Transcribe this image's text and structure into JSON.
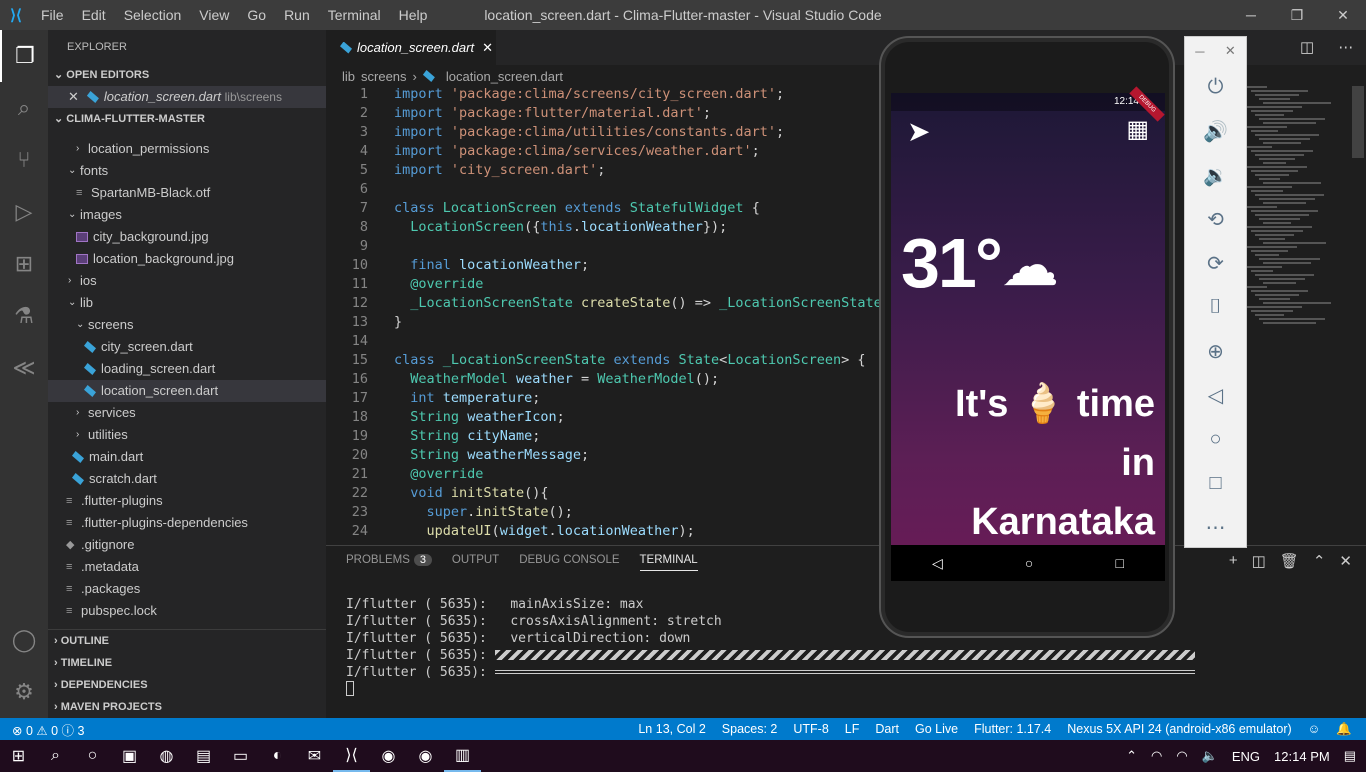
{
  "titlebar": {
    "menu": [
      "File",
      "Edit",
      "Selection",
      "View",
      "Go",
      "Run",
      "Terminal",
      "Help"
    ],
    "title": "location_screen.dart - Clima-Flutter-master - Visual Studio Code"
  },
  "sidebar": {
    "header": "EXPLORER",
    "open_editors": "OPEN EDITORS",
    "open_file": "location_screen.dart",
    "open_path": "lib\\screens",
    "project": "CLIMA-FLUTTER-MASTER",
    "tree": [
      "location_permissions",
      "fonts",
      "SpartanMB-Black.otf",
      "images",
      "city_background.jpg",
      "location_background.jpg",
      "ios",
      "lib",
      "screens",
      "city_screen.dart",
      "loading_screen.dart",
      "location_screen.dart",
      "services",
      "utilities",
      "main.dart",
      "scratch.dart",
      ".flutter-plugins",
      ".flutter-plugins-dependencies",
      ".gitignore",
      ".metadata",
      ".packages",
      "pubspec.lock"
    ],
    "sections": [
      "OUTLINE",
      "TIMELINE",
      "DEPENDENCIES",
      "MAVEN PROJECTS"
    ]
  },
  "tab": {
    "label": "location_screen.dart"
  },
  "breadcrumb": [
    "lib",
    "screens",
    "location_screen.dart"
  ],
  "code": {
    "line_numbers": [
      "1",
      "2",
      "3",
      "4",
      "5",
      "6",
      "7",
      "8",
      "9",
      "10",
      "11",
      "12",
      "13",
      "14",
      "15",
      "16",
      "17",
      "18",
      "19",
      "20",
      "21",
      "22",
      "23",
      "24"
    ]
  },
  "panel": {
    "tabs": [
      "PROBLEMS",
      "OUTPUT",
      "DEBUG CONSOLE",
      "TERMINAL"
    ],
    "problems_count": "3",
    "terminal": [
      "I/flutter ( 5635):   mainAxisSize: max",
      "I/flutter ( 5635):   crossAxisAlignment: stretch",
      "I/flutter ( 5635):   verticalDirection: down",
      "I/flutter ( 5635):",
      "I/flutter ( 5635):"
    ]
  },
  "statusbar": {
    "errors": "0",
    "warnings": "0",
    "info": "3",
    "items": [
      "Ln 13, Col 2",
      "Spaces: 2",
      "UTF-8",
      "LF",
      "Dart",
      "Go Live",
      "Flutter: 1.17.4",
      "Nexus 5X API 24 (android-x86 emulator)"
    ]
  },
  "phone": {
    "time": "12:14",
    "temperature": "31°",
    "message_1": "It's 🍦 time",
    "message_2": "in",
    "message_3": "Karnataka",
    "debug": "DEBUG"
  },
  "taskbar": {
    "lang": "ENG",
    "time": "12:14 PM"
  },
  "colors": {
    "accent": "#007acc",
    "taskbar": "#1f0c1d"
  }
}
